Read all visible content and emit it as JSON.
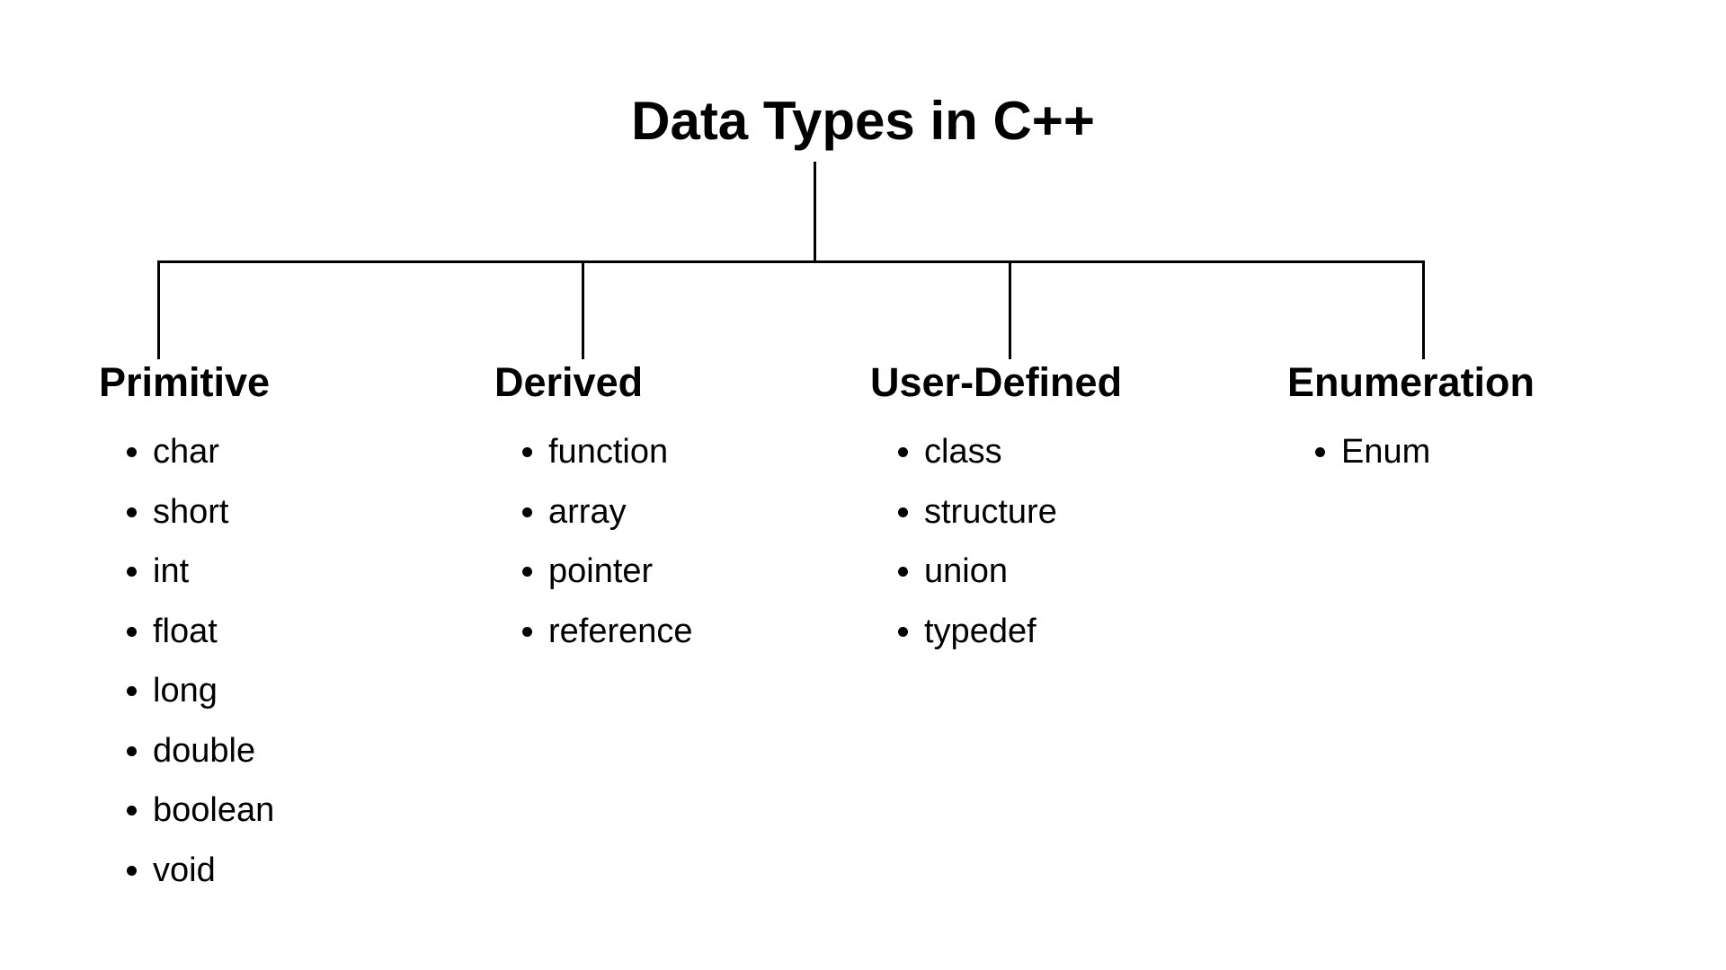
{
  "title": "Data Types in C++",
  "sections": [
    {
      "heading": "Primitive",
      "items": [
        "char",
        "short",
        "int",
        "float",
        "long",
        "double",
        "boolean",
        "void"
      ]
    },
    {
      "heading": "Derived",
      "items": [
        "function",
        "array",
        "pointer",
        "reference"
      ]
    },
    {
      "heading": "User-Defined",
      "items": [
        "class",
        "structure",
        "union",
        "typedef"
      ]
    },
    {
      "heading": "Enumeration",
      "items": [
        "Enum"
      ]
    }
  ]
}
